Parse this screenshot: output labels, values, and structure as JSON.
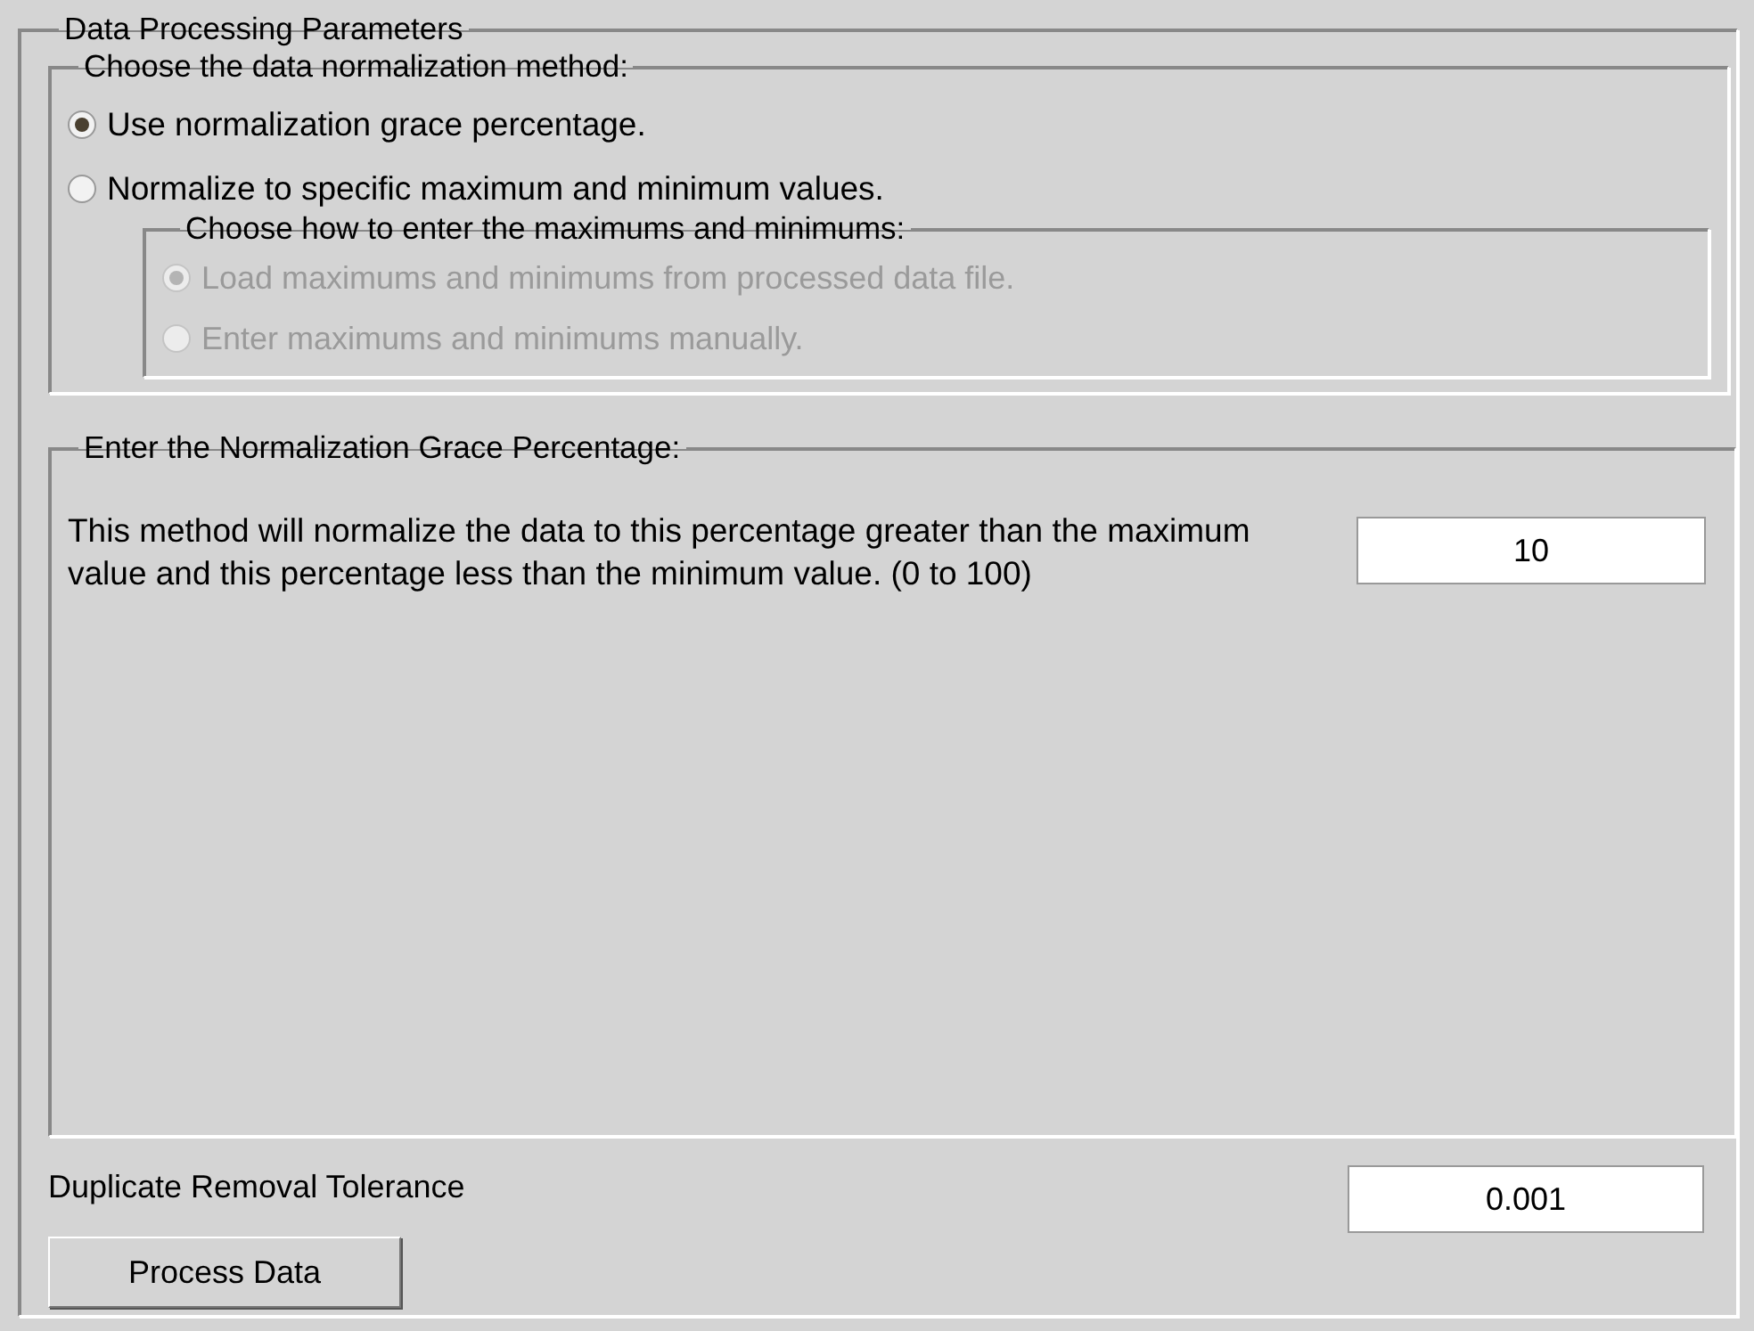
{
  "panel": {
    "title": "Data Processing Parameters",
    "method_group": {
      "title": "Choose the data normalization method:",
      "options": [
        {
          "label": "Use normalization grace percentage.",
          "selected": true
        },
        {
          "label": "Normalize to specific maximum and minimum values.",
          "selected": false
        }
      ],
      "sub_group": {
        "title": "Choose how to enter the maximums and minimums:",
        "disabled": true,
        "options": [
          {
            "label": "Load maximums and minimums from processed data file.",
            "selected": true
          },
          {
            "label": "Enter maximums and minimums manually.",
            "selected": false
          }
        ]
      }
    },
    "grace_group": {
      "title": "Enter the Normalization Grace Percentage:",
      "description": "This method will normalize the data to this percentage greater than the maximum value and this percentage less than the minimum value. (0 to 100)",
      "value": "10"
    },
    "tolerance": {
      "label": "Duplicate Removal Tolerance",
      "value": "0.001"
    },
    "buttons": [
      "Process Data"
    ]
  }
}
